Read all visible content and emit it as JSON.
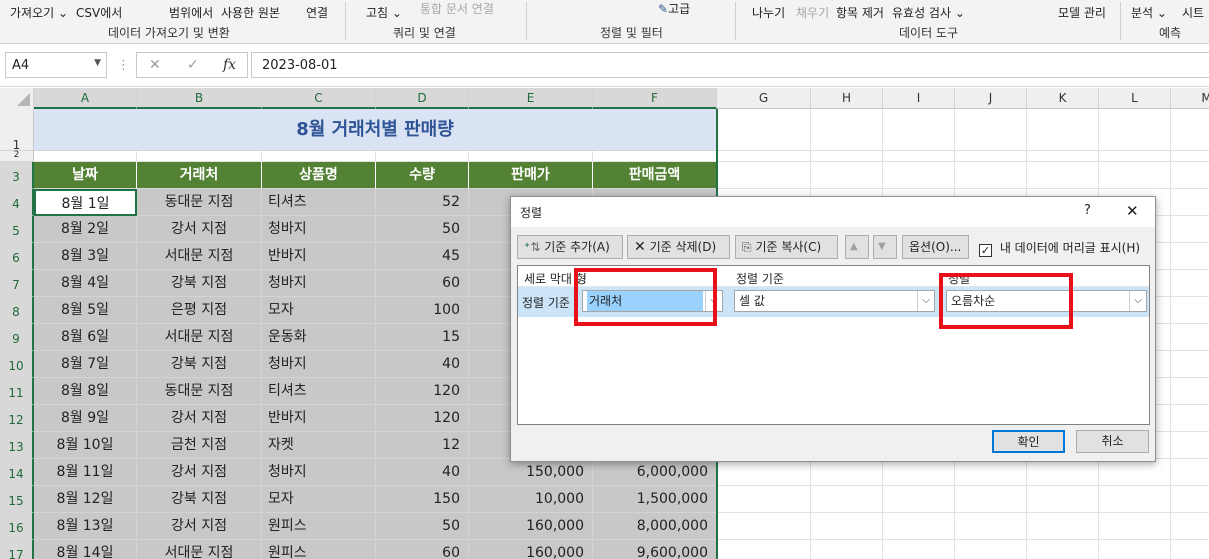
{
  "ribbon": {
    "row1": [
      {
        "text": "가져오기 ⌄",
        "dim": false
      },
      {
        "text": "CSV에서",
        "dim": false
      },
      {
        "text": "범위에서",
        "dim": false
      },
      {
        "text": "사용한 원본",
        "dim": false
      },
      {
        "text": "연결",
        "dim": false
      },
      {
        "text": "고침 ⌄",
        "dim": false
      },
      {
        "text": "통합 문서 연결",
        "dim": true
      },
      {
        "text": "고급",
        "dim": false
      },
      {
        "text": "나누기",
        "dim": false
      },
      {
        "text": "채우기",
        "dim": true
      },
      {
        "text": "항목 제거",
        "dim": false
      },
      {
        "text": "유효성 검사 ⌄",
        "dim": false
      },
      {
        "text": "모델 관리",
        "dim": false
      },
      {
        "text": "분석 ⌄",
        "dim": false
      },
      {
        "text": "시트",
        "dim": false
      }
    ],
    "groups": [
      "데이터 가져오기 및 변환",
      "쿼리 및 연결",
      "정렬 및 필터",
      "데이터 도구",
      "예측"
    ]
  },
  "formula_bar": {
    "name_box": "A4",
    "fx": "fx",
    "cancel": "✕",
    "enter": "✓",
    "value": "2023-08-01"
  },
  "columns": [
    "A",
    "B",
    "C",
    "D",
    "E",
    "F",
    "G",
    "H",
    "I",
    "J",
    "K",
    "L",
    "M"
  ],
  "rows": [
    "1",
    "2",
    "3",
    "4",
    "5",
    "6",
    "7",
    "8",
    "9",
    "10",
    "11",
    "12",
    "13",
    "14",
    "15",
    "16",
    "17"
  ],
  "sheet": {
    "title": "8월 거래처별 판매량",
    "headers": [
      "날짜",
      "거래처",
      "상품명",
      "수량",
      "판매가",
      "판매금액"
    ],
    "data": [
      [
        "8월 1일",
        "동대문 지점",
        "티셔츠",
        "52",
        "",
        ""
      ],
      [
        "8월 2일",
        "강서 지점",
        "청바지",
        "50",
        "",
        ""
      ],
      [
        "8월 3일",
        "서대문 지점",
        "반바지",
        "45",
        "",
        ""
      ],
      [
        "8월 4일",
        "강북 지점",
        "청바지",
        "60",
        "",
        ""
      ],
      [
        "8월 5일",
        "은평 지점",
        "모자",
        "100",
        "",
        ""
      ],
      [
        "8월 6일",
        "서대문 지점",
        "운동화",
        "15",
        "",
        ""
      ],
      [
        "8월 7일",
        "강북 지점",
        "청바지",
        "40",
        "",
        ""
      ],
      [
        "8월 8일",
        "동대문 지점",
        "티셔츠",
        "120",
        "",
        ""
      ],
      [
        "8월 9일",
        "강서 지점",
        "반바지",
        "120",
        "",
        ""
      ],
      [
        "8월 10일",
        "금천 지점",
        "자켓",
        "12",
        "",
        ""
      ],
      [
        "8월 11일",
        "강서 지점",
        "청바지",
        "40",
        "150,000",
        "6,000,000"
      ],
      [
        "8월 12일",
        "강북 지점",
        "모자",
        "150",
        "10,000",
        "1,500,000"
      ],
      [
        "8월 13일",
        "강서 지점",
        "원피스",
        "50",
        "160,000",
        "8,000,000"
      ],
      [
        "8월 14일",
        "서대문 지점",
        "원피스",
        "60",
        "160,000",
        "9,600,000"
      ]
    ]
  },
  "dialog": {
    "title": "정렬",
    "help": "?",
    "close": "✕",
    "add_level": "기준 추가(A)",
    "delete_level": "기준 삭제(D)",
    "copy_level": "기준 복사(C)",
    "move_up": "▲",
    "move_down": "▼",
    "options": "옵션(O)...",
    "headers_checkbox": "내 데이터에 머리글 표시(H)",
    "headers_checked": true,
    "col_header": "세로 막대 형",
    "sorton_header": "정렬 기준",
    "order_header": "정렬",
    "row_label": "정렬 기준",
    "column_value": "거래처",
    "sorton_value": "셀 값",
    "order_value": "오름차순",
    "ok": "확인",
    "cancel": "취소"
  },
  "colors": {
    "header_green": "#548235",
    "title_band": "#dae3f3",
    "title_text": "#2f5597",
    "highlight_red": "#e8111a",
    "selection_blue": "#99d1ff"
  }
}
